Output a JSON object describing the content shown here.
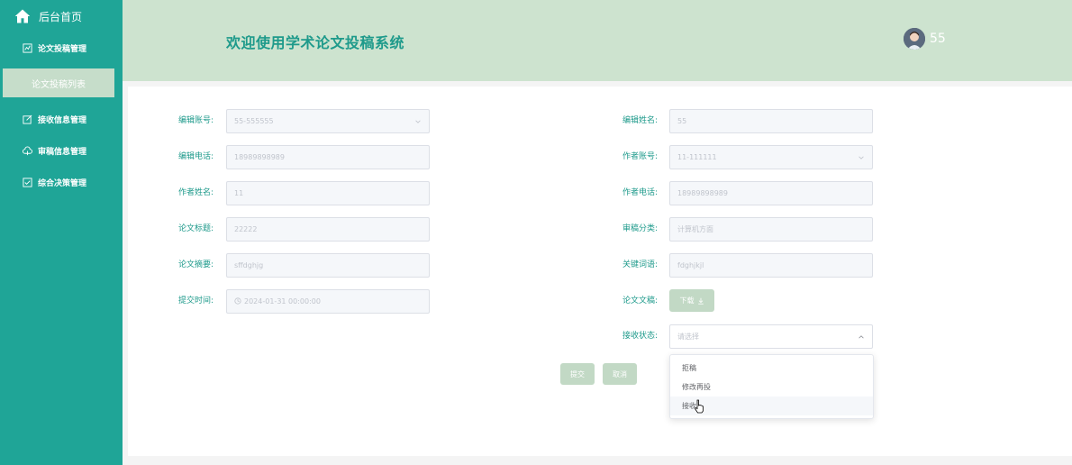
{
  "sidebar": {
    "brand_label": "后台首页",
    "menu_items": [
      {
        "label": "论文投稿管理"
      },
      {
        "label": "接收信息管理"
      },
      {
        "label": "审稿信息管理"
      },
      {
        "label": "综合决策管理"
      }
    ],
    "active_submenu_label": "论文投稿列表"
  },
  "header": {
    "title": "欢迎使用学术论文投稿系统",
    "username": "55"
  },
  "form": {
    "editor_account": {
      "label": "编辑账号:",
      "value": "55-555555"
    },
    "editor_name": {
      "label": "编辑姓名:",
      "value": "55"
    },
    "editor_phone": {
      "label": "编辑电话:",
      "value": "18989898989"
    },
    "author_account": {
      "label": "作者账号:",
      "value": "11-111111"
    },
    "author_name": {
      "label": "作者姓名:",
      "value": "11"
    },
    "author_phone": {
      "label": "作者电话:",
      "value": "18989898989"
    },
    "paper_title": {
      "label": "论文标题:",
      "value": "22222"
    },
    "review_category": {
      "label": "审稿分类:",
      "value": "计算机方面"
    },
    "paper_abstract": {
      "label": "论文摘要:",
      "value": "sffdghjg"
    },
    "keywords": {
      "label": "关键词语:",
      "value": "fdghjkjl"
    },
    "submit_time": {
      "label": "提交时间:",
      "value": "2024-01-31 00:00:00"
    },
    "paper_file": {
      "label": "论文文稿:",
      "download_label": "下载"
    },
    "receive_status": {
      "label": "接收状态:",
      "placeholder": "请选择"
    }
  },
  "buttons": {
    "submit": "提交",
    "cancel": "取消"
  },
  "dropdown": {
    "options": [
      "拒稿",
      "修改再投",
      "接收"
    ],
    "hovered_index": 2
  },
  "colors": {
    "sidebar_bg": "#1fa597",
    "header_bg": "#cde3cf",
    "accent_text": "#1e9a8b",
    "button_bg": "#c2d9c5"
  }
}
